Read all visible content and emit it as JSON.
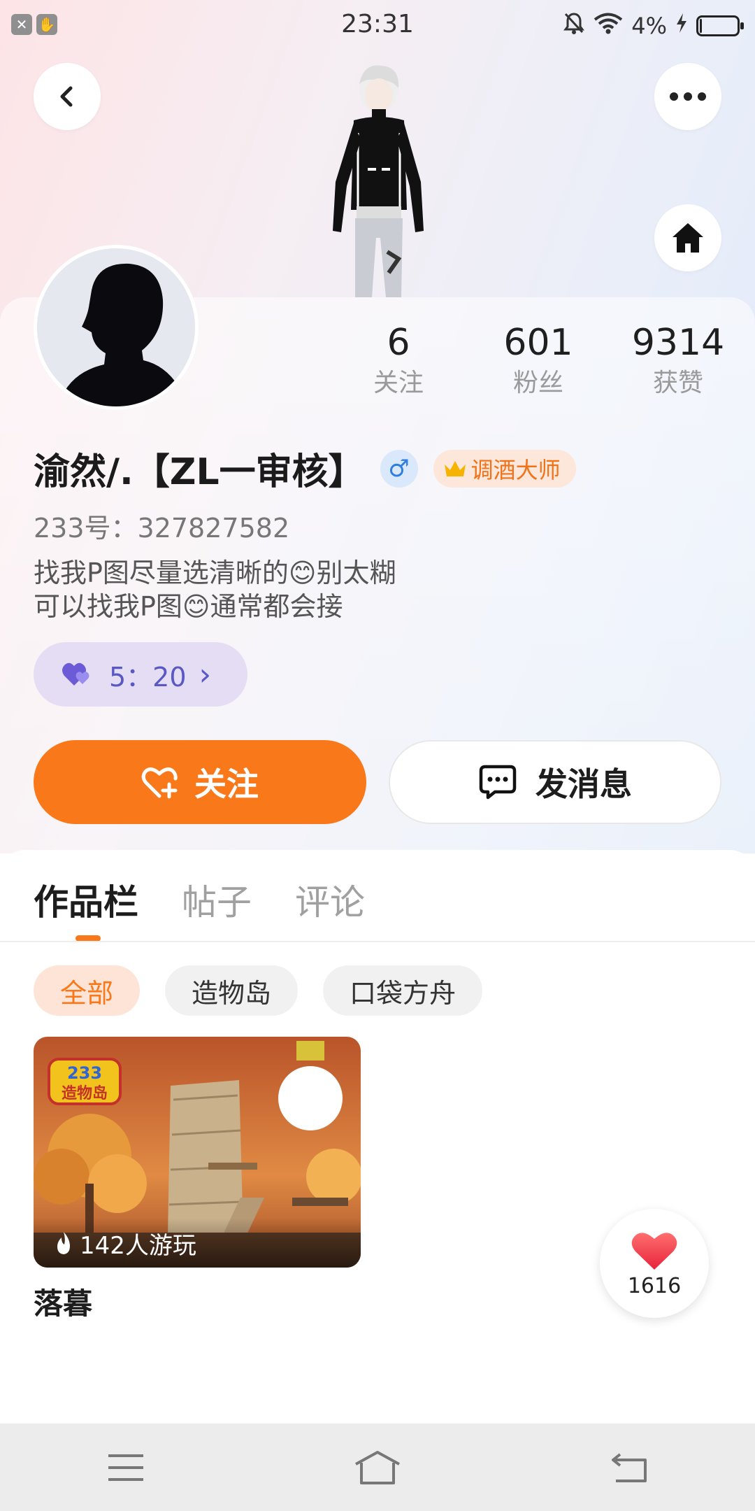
{
  "status_bar": {
    "time": "23:31",
    "battery": "4%",
    "battery_level": 0.04
  },
  "profile": {
    "username": "渝然/.【ZL一审核】",
    "gender_symbol": "♂",
    "title_badge": "调酒大师",
    "user_id": "233号：327827582",
    "bio_line1": "找我P图尽量选清晰的😊别太糊",
    "bio_line2": "可以找我P图😊通常都会接",
    "heart_pill": "5：20",
    "heart_pill_chevron": "›"
  },
  "stats": [
    {
      "value": "6",
      "label": "关注"
    },
    {
      "value": "601",
      "label": "粉丝"
    },
    {
      "value": "9314",
      "label": "获赞"
    }
  ],
  "actions": {
    "follow_label": "关注",
    "message_label": "发消息"
  },
  "tabs": [
    {
      "label": "作品栏",
      "active": true
    },
    {
      "label": "帖子",
      "active": false
    },
    {
      "label": "评论",
      "active": false
    }
  ],
  "filters": [
    {
      "label": "全部",
      "active": true
    },
    {
      "label": "造物岛",
      "active": false
    },
    {
      "label": "口袋方舟",
      "active": false
    }
  ],
  "works": [
    {
      "badge_line1": "233",
      "badge_line2": "造物岛",
      "play_count": "142人游玩",
      "title": "落暮"
    }
  ],
  "like_fab": {
    "count": "1616"
  },
  "colors": {
    "accent": "#f97819",
    "heart_pill_bg": "#e4ddf4",
    "heart_pill_fg": "#5a58c5",
    "gender": "#2f7fe0",
    "like": "#f5334a"
  },
  "icons": [
    "back-icon",
    "more-icon",
    "home-icon",
    "heart-plus-icon",
    "chat-icon",
    "heart-icon",
    "flame-icon",
    "menu-icon",
    "nav-home-icon",
    "nav-back-icon"
  ]
}
